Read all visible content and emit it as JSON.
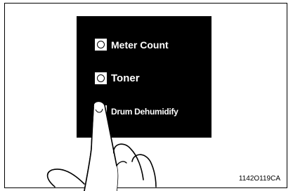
{
  "menu": {
    "items": [
      {
        "label": "Meter Count"
      },
      {
        "label": "Toner"
      },
      {
        "label": "Drum Dehumidify"
      }
    ]
  },
  "caption": "1142O119CA",
  "colors": {
    "panel": "#000000",
    "label": "#ffffff",
    "frame": "#000000"
  },
  "icons": {
    "pointer": "pointing-hand-icon",
    "radio": "radio-button-icon"
  }
}
